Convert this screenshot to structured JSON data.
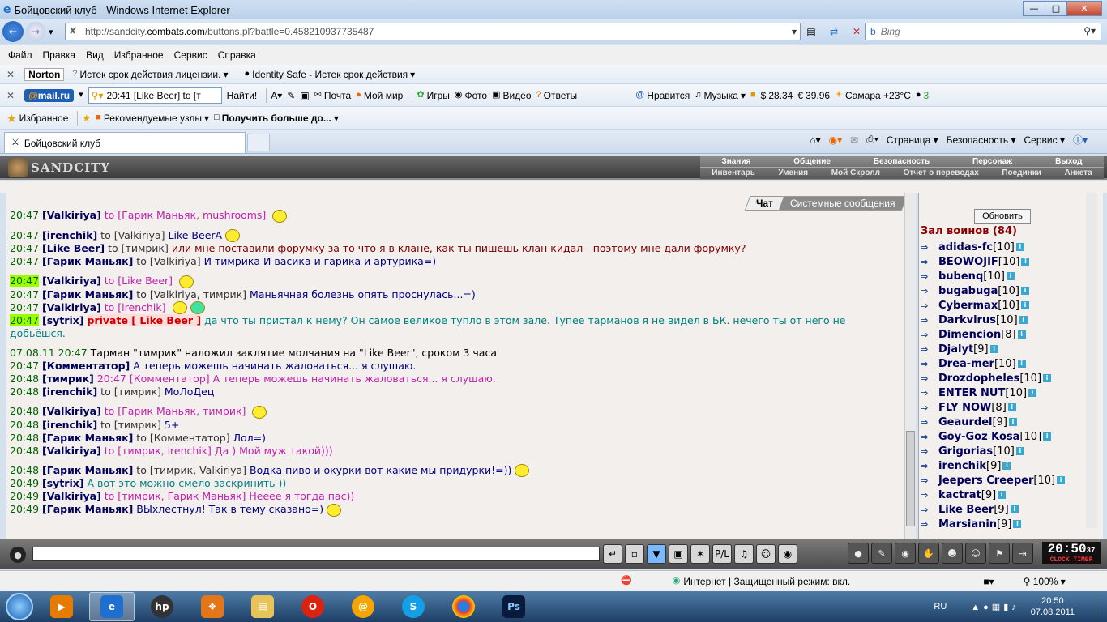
{
  "window": {
    "title": "Бойцовский клуб - Windows Internet Explorer"
  },
  "address": {
    "url_prefix": "http://sandcity.",
    "url_domain": "combats.com",
    "url_path": "/buttons.pl?battle=0.458210937735487",
    "search_placeholder": "Bing"
  },
  "menu": [
    "Файл",
    "Правка",
    "Вид",
    "Избранное",
    "Сервис",
    "Справка"
  ],
  "norton": {
    "logo": "Norton",
    "item1": "Истек срок действия лицензии.",
    "item2": "Identity Safe - Истек срок действия"
  },
  "mailru": {
    "logo_a": "@",
    "logo_b": "mail.ru",
    "search_value": "20:41 [Like Beer] to [т",
    "find": "Найти!",
    "items": [
      "Почта",
      "Мой мир",
      "Игры",
      "Фото",
      "Видео",
      "Ответы"
    ],
    "like": "Нравится",
    "music": "Музыка",
    "usd": "28.34",
    "eur": "39.96",
    "weather": "Самара +23°C",
    "count": "3"
  },
  "favbar": {
    "favorites": "Избранное",
    "recommended": "Рекомендуемые узлы",
    "more": "Получить больше до..."
  },
  "tabs": {
    "active": "Бойцовский клуб",
    "page": "Страница",
    "safety": "Безопасность",
    "service": "Сервис"
  },
  "game": {
    "logo": "SANDCITY",
    "menu_top": [
      "Знания",
      "Общение",
      "Безопасность",
      "Персонаж",
      "Выход"
    ],
    "menu_bottom": [
      "Инвентарь",
      "Умения",
      "Мой Скролл",
      "Отчет о переводах",
      "Поединки",
      "Анкета"
    ],
    "chat_tab": "Чат",
    "sys_tab": "Системные сообщения",
    "refresh": "Обновить",
    "room_title": "Зал воинов (84)",
    "clock": "20:50",
    "clock_sec": "37",
    "clock_label": "CLOCK TIMER",
    "players": [
      {
        "name": "adidas-fc",
        "lvl": "[10]"
      },
      {
        "name": "BEOWOJIF",
        "lvl": "[10]"
      },
      {
        "name": "bubenq",
        "lvl": "[10]"
      },
      {
        "name": "bugabuga",
        "lvl": "[10]"
      },
      {
        "name": "Cybermax",
        "lvl": "[10]"
      },
      {
        "name": "Darkvirus",
        "lvl": "[10]"
      },
      {
        "name": "Dimencion",
        "lvl": "[8]"
      },
      {
        "name": "Djalyt",
        "lvl": "[9]"
      },
      {
        "name": "Drea-mer",
        "lvl": "[10]"
      },
      {
        "name": "Drozdopheles",
        "lvl": "[10]"
      },
      {
        "name": "ENTER NUT",
        "lvl": "[10]"
      },
      {
        "name": "FLY NOW",
        "lvl": "[8]"
      },
      {
        "name": "Geaurdel",
        "lvl": "[9]"
      },
      {
        "name": "Goy-Goz Kosa",
        "lvl": "[10]"
      },
      {
        "name": "Grigorias",
        "lvl": "[10]"
      },
      {
        "name": "irenchik",
        "lvl": "[9]"
      },
      {
        "name": "Jeepers Creeper",
        "lvl": "[10]"
      },
      {
        "name": "kactrat",
        "lvl": "[9]"
      },
      {
        "name": "Like Beer",
        "lvl": "[9]"
      },
      {
        "name": "Marsianin",
        "lvl": "[9]"
      }
    ]
  },
  "chat": [
    {
      "t": "20:47",
      "n": "[Valkiriya]",
      "to": "to [Гарик Маньяк, mushrooms]",
      "x": "",
      "cls": "pur"
    },
    {
      "t": "20:47",
      "n": "[irenchik]",
      "to": "to [Valkiriya]",
      "x": "Like BeerA",
      "cls": "txt"
    },
    {
      "t": "20:47",
      "n": "[Like Beer]",
      "to": "to [тимрик]",
      "x": "или мне поставили форумку за то что я в клане, как ты пишешь клан кидал - поэтому мне дали форумку?",
      "cls": "red"
    },
    {
      "t": "20:47",
      "n": "[Гарик Маньяк]",
      "to": "to [Valkiriya]",
      "x": "И тимрика И васика и гарика и артурика=)",
      "cls": "txt"
    },
    {
      "t": "20:47",
      "n": "[Valkiriya]",
      "to": "to [Like Beer]",
      "x": "",
      "cls": "pur"
    },
    {
      "t": "20:47",
      "n": "[Гарик Маньяк]",
      "to": "to [Valkiriya, тимрик]",
      "x": "Маньячная болезнь опять проснулась...=)",
      "cls": "txt"
    },
    {
      "t": "20:47",
      "n": "[Valkiriya]",
      "to": "to [irenchik]",
      "x": "",
      "cls": "pur"
    },
    {
      "t": "20:47",
      "n": "[sytrix]",
      "to": "private [ Like Beer ]",
      "x": "да что ты пристал к нему? Он самое великое тупло в этом зале. Тупее тарманов я не видел в БК. нечего ты от него не добьёшся.",
      "cls": "gr"
    },
    {
      "t": "07.08.11 20:47",
      "n": "",
      "to": "",
      "x": "Тарман \"тимрик\" наложил заклятие молчания на \"Like Beer\", сроком 3 часа",
      "cls": "sys"
    },
    {
      "t": "20:47",
      "n": "[Комментатор]",
      "to": "",
      "x": "А теперь можешь начинать жаловаться... я слушаю.",
      "cls": "txt"
    },
    {
      "t": "20:48",
      "n": "[тимрик]",
      "to": "",
      "x": "20:47 [Комментатор] А теперь можешь начинать жаловаться... я слушаю.",
      "cls": "pur"
    },
    {
      "t": "20:48",
      "n": "[irenchik]",
      "to": "to [тимрик]",
      "x": "МоЛоДец",
      "cls": "txt"
    },
    {
      "t": "20:48",
      "n": "[Valkiriya]",
      "to": "to [Гарик Маньяк, тимрик]",
      "x": "",
      "cls": "pur"
    },
    {
      "t": "20:48",
      "n": "[irenchik]",
      "to": "to [тимрик]",
      "x": "5+",
      "cls": "txt"
    },
    {
      "t": "20:48",
      "n": "[Гарик Маньяк]",
      "to": "to [Комментатор]",
      "x": "Лол=)",
      "cls": "txt"
    },
    {
      "t": "20:48",
      "n": "[Valkiriya]",
      "to": "to [тимрик, irenchik]",
      "x": "Да ) Мой муж такой)))",
      "cls": "pur"
    },
    {
      "t": "20:48",
      "n": "[Гарик Маньяк]",
      "to": "to [тимрик, Valkiriya]",
      "x": "Водка пиво и окурки-вот какие мы придурки!=))",
      "cls": "txt"
    },
    {
      "t": "20:49",
      "n": "[sytrix]",
      "to": "",
      "x": "А вот это можно смело заскринить ))",
      "cls": "gr"
    },
    {
      "t": "20:49",
      "n": "[Valkiriya]",
      "to": "to [тимрик, Гарик Маньяк]",
      "x": "Нееее я тогда пас))",
      "cls": "pur"
    },
    {
      "t": "20:49",
      "n": "[Гарик Маньяк]",
      "to": "",
      "x": "ВЫхлестнул! Так в тему сказано=)",
      "cls": "txt"
    }
  ],
  "status": {
    "zone": "Интернет | Защищенный режим: вкл.",
    "zoom": "100%"
  },
  "tray": {
    "lang": "RU",
    "time": "20:50",
    "date": "07.08.2011"
  }
}
